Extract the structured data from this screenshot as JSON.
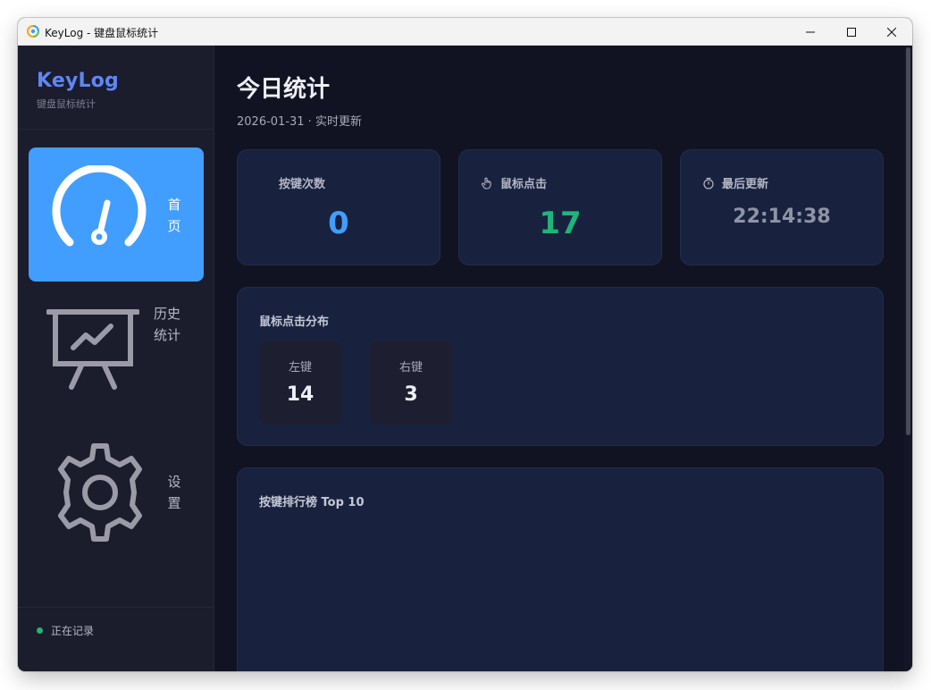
{
  "window": {
    "title": "KeyLog - 键盘鼠标统计"
  },
  "sidebar": {
    "brand_name": "KeyLog",
    "brand_subtitle": "键盘鼠标统计",
    "items": [
      {
        "label": "首页",
        "icon": "dashboard-gauge-icon",
        "active": true
      },
      {
        "label": "历史统计",
        "icon": "presentation-chart-icon",
        "active": false
      },
      {
        "label": "设置",
        "icon": "gear-icon",
        "active": false
      }
    ],
    "status_text": "正在记录",
    "status_color": "#22b573"
  },
  "main": {
    "title": "今日统计",
    "subtitle": "2026-01-31 · 实时更新",
    "stats": [
      {
        "label": "按键次数",
        "value": "0",
        "color": "#419eff",
        "icon": ""
      },
      {
        "label": "鼠标点击",
        "value": "17",
        "color": "#1fb57a",
        "icon": "hand-pointer-icon"
      },
      {
        "label": "最后更新",
        "value": "22:14:38",
        "color": "#8e93a6",
        "icon": "stopwatch-icon"
      }
    ],
    "mouse_distribution": {
      "title": "鼠标点击分布",
      "items": [
        {
          "label": "左键",
          "value": "14"
        },
        {
          "label": "右键",
          "value": "3"
        }
      ]
    },
    "key_ranking": {
      "title": "按键排行榜 Top 10"
    }
  },
  "colors": {
    "accent": "#419eff",
    "sidebar_bg": "#1b1c2c",
    "main_bg": "#111322",
    "card_bg": "#18223e"
  }
}
